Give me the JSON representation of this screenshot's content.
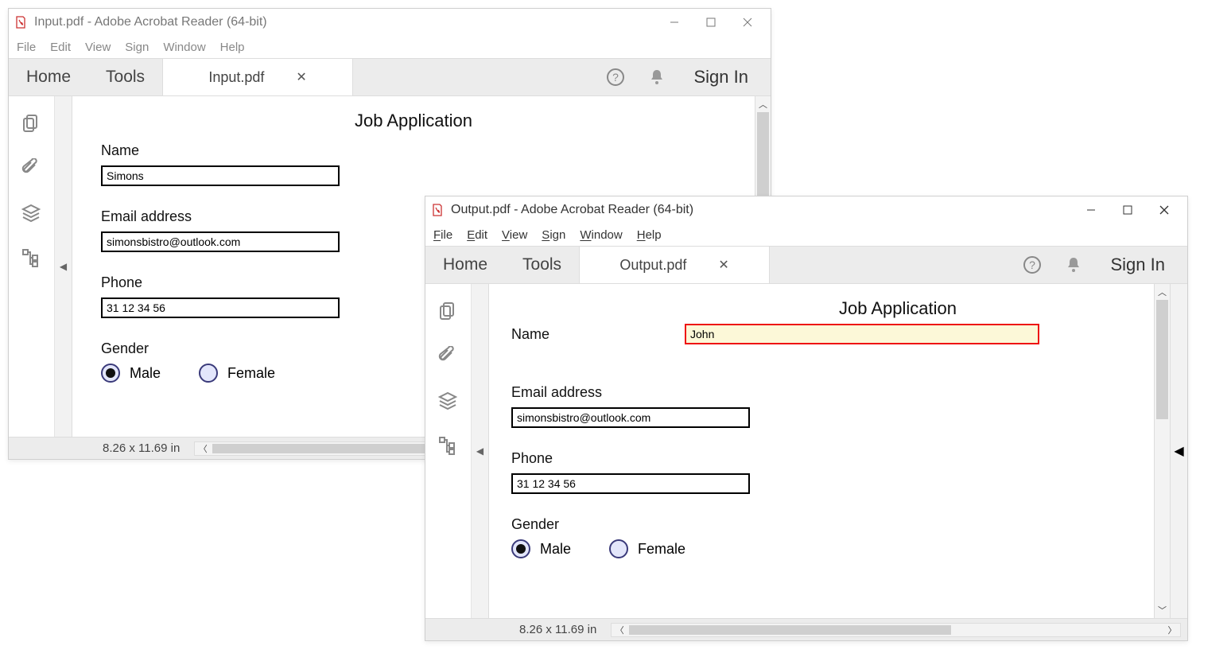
{
  "windows": {
    "input": {
      "title": "Input.pdf - Adobe Acrobat Reader (64-bit)",
      "tab_label": "Input.pdf",
      "active": false
    },
    "output": {
      "title": "Output.pdf - Adobe Acrobat Reader (64-bit)",
      "tab_label": "Output.pdf",
      "active": true
    }
  },
  "menu": {
    "file": "File",
    "edit": "Edit",
    "view": "View",
    "sign": "Sign",
    "window": "Window",
    "help": "Help"
  },
  "toolbar": {
    "home": "Home",
    "tools": "Tools",
    "signin": "Sign In"
  },
  "doc": {
    "title": "Job Application",
    "name_label": "Name",
    "email_label": "Email address",
    "phone_label": "Phone",
    "gender_label": "Gender",
    "male": "Male",
    "female": "Female"
  },
  "input_values": {
    "name": "Simons",
    "email": "simonsbistro@outlook.com",
    "phone": "31 12 34 56"
  },
  "output_values": {
    "name": "John",
    "email": "simonsbistro@outlook.com",
    "phone": "31 12 34 56"
  },
  "status": {
    "dimensions": "8.26 x 11.69 in"
  }
}
